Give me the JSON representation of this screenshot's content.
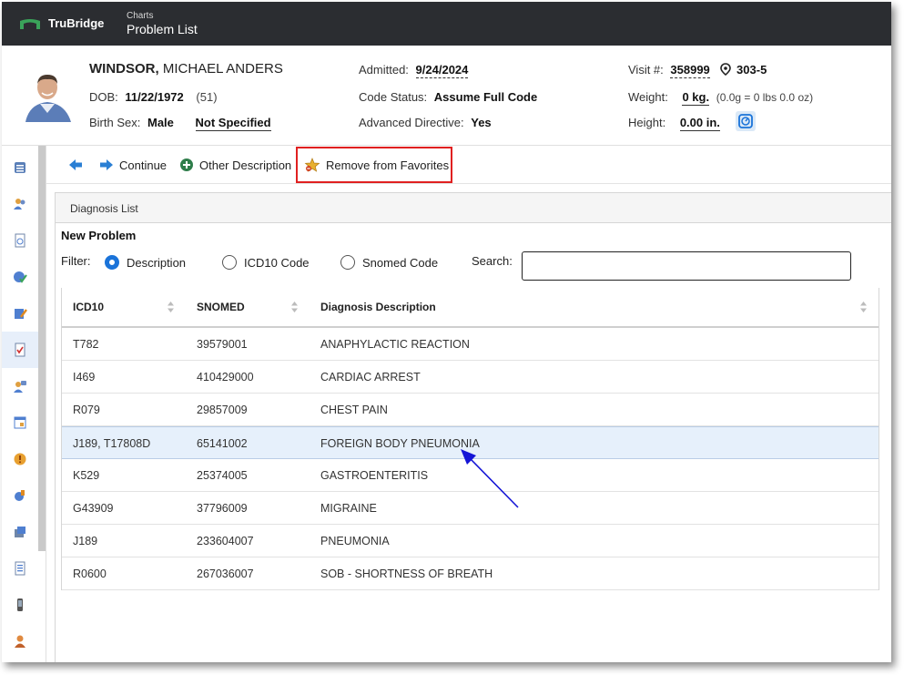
{
  "app": {
    "brand": "TruBridge",
    "section": "Charts",
    "page_title": "Problem List"
  },
  "patient": {
    "last_name": "WINDSOR,",
    "first_middle": "MICHAEL ANDERS",
    "dob_label": "DOB:",
    "dob": "11/22/1972",
    "age": "(51)",
    "birth_sex_label": "Birth Sex:",
    "birth_sex": "Male",
    "gender_identity": "Not Specified",
    "admitted_label": "Admitted:",
    "admitted": "9/24/2024",
    "code_status_label": "Code Status:",
    "code_status": "Assume Full Code",
    "adv_directive_label": "Advanced Directive:",
    "adv_directive": "Yes",
    "visit_label": "Visit #:",
    "visit": "358999",
    "room": "303-5",
    "weight_label": "Weight:",
    "weight": "0 kg.",
    "weight_note": "(0.0g = 0 lbs 0.0 oz)",
    "height_label": "Height:",
    "height": "0.00 in."
  },
  "toolbar": {
    "continue_label": "Continue",
    "other_desc_label": "Other Description",
    "remove_fav_label": "Remove from Favorites"
  },
  "panel": {
    "title": "Diagnosis List",
    "new_problem": "New Problem",
    "filter_label": "Filter:",
    "filters": [
      "Description",
      "ICD10 Code",
      "Snomed Code"
    ],
    "selected_filter": "Description",
    "search_label": "Search:",
    "search_value": ""
  },
  "grid": {
    "columns": [
      "ICD10",
      "SNOMED",
      "Diagnosis Description"
    ],
    "rows": [
      {
        "icd10": "T782",
        "snomed": "39579001",
        "desc": "ANAPHYLACTIC REACTION"
      },
      {
        "icd10": "I469",
        "snomed": "410429000",
        "desc": "CARDIAC ARREST"
      },
      {
        "icd10": "R079",
        "snomed": "29857009",
        "desc": "CHEST PAIN"
      },
      {
        "icd10": "J189, T17808D",
        "snomed": "65141002",
        "desc": "FOREIGN BODY PNEUMONIA"
      },
      {
        "icd10": "K529",
        "snomed": "25374005",
        "desc": "GASTROENTERITIS"
      },
      {
        "icd10": "G43909",
        "snomed": "37796009",
        "desc": "MIGRAINE"
      },
      {
        "icd10": "J189",
        "snomed": "233604007",
        "desc": "PNEUMONIA"
      },
      {
        "icd10": "R0600",
        "snomed": "267036007",
        "desc": "SOB - SHORTNESS OF BREATH"
      }
    ],
    "selected_row": "FOREIGN BODY PNEUMONIA"
  },
  "nav_icons": [
    "database-icon",
    "people-icon",
    "document-icon",
    "globe-check-icon",
    "chart-edit-icon",
    "checklist-icon",
    "person-chat-icon",
    "calendar-icon",
    "alert-icon",
    "lab-icon",
    "medication-icon",
    "notes-icon",
    "device-icon",
    "person-icon"
  ],
  "colors": {
    "topbar": "#2b2d31",
    "accent": "#1a73d9",
    "highlight": "#e02020",
    "selected_row": "#e6f0fb",
    "annotation_arrow": "#1515d6"
  }
}
